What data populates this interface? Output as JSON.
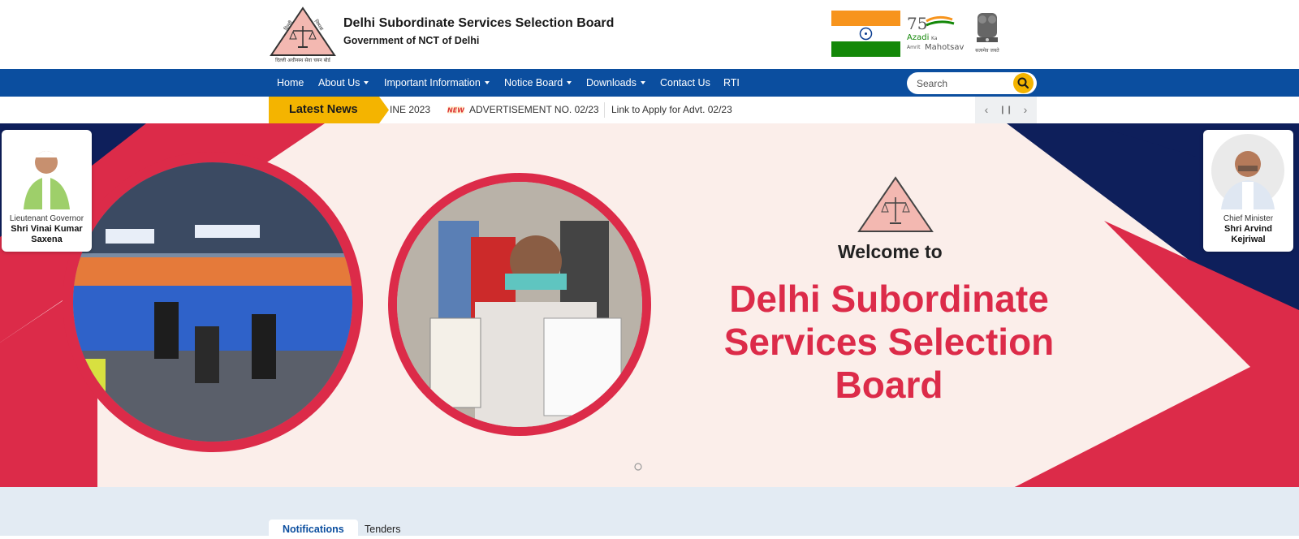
{
  "header": {
    "title": "Delhi Subordinate Services Selection Board",
    "subtitle": "Government of NCT of Delhi",
    "logo_text_top": "दिल्ली अधीनस्थ सेवा चयन बोर्ड",
    "azadi_text": "Azadi Ka Amrit Mahotsav",
    "emblem_text": "सत्यमेव जयते"
  },
  "nav": {
    "items": [
      {
        "label": "Home",
        "dropdown": false
      },
      {
        "label": "About Us",
        "dropdown": true
      },
      {
        "label": "Important Information",
        "dropdown": true
      },
      {
        "label": "Notice Board",
        "dropdown": true
      },
      {
        "label": "Downloads",
        "dropdown": true
      },
      {
        "label": "Contact Us",
        "dropdown": false
      },
      {
        "label": "RTI",
        "dropdown": false
      }
    ],
    "search_placeholder": "Search"
  },
  "ticker": {
    "label": "Latest News",
    "item1": "INE 2023",
    "new_badge": "NEW",
    "item2": "ADVERTISEMENT NO. 02/23",
    "item3": "Link to Apply for Advt. 02/23",
    "controls": {
      "prev": "‹",
      "pause": "❙❙",
      "next": "›"
    }
  },
  "banner": {
    "welcome": "Welcome to",
    "title_lines": [
      "Delhi Subordinate",
      "Services Selection",
      "Board"
    ],
    "left_person": {
      "role": "Lieutenant Governor",
      "name_line1": "Shri Vinai Kumar",
      "name_line2": "Saxena"
    },
    "right_person": {
      "role": "Chief Minister",
      "name_line1": "Shri Arvind",
      "name_line2": "Kejriwal"
    }
  },
  "tabs": [
    "Notifications",
    "Tenders"
  ],
  "colors": {
    "nav_blue": "#0b4e9f",
    "accent_red": "#dc2b49",
    "ticker_yellow": "#f4b400",
    "navy": "#0e1f5b"
  }
}
